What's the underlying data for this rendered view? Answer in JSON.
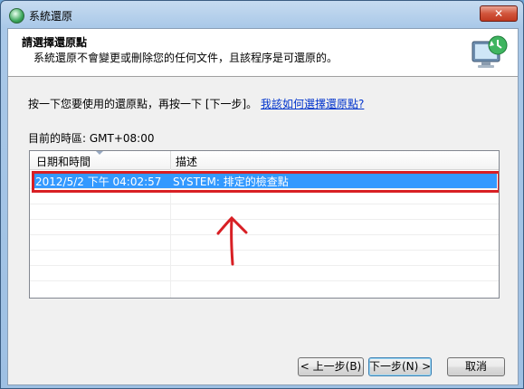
{
  "window": {
    "title": "系統還原",
    "close_label": "✕"
  },
  "header": {
    "title": "請選擇還原點",
    "subtitle": "系統還原不會變更或刪除您的任何文件，且該程序是可還原的。"
  },
  "instruction": {
    "text": "按一下您要使用的還原點，再按一下 [下一步]。",
    "link": "我該如何選擇還原點?"
  },
  "timezone": {
    "text": "目前的時區: GMT+08:00"
  },
  "list": {
    "columns": [
      "日期和時間",
      "描述"
    ],
    "rows": [
      {
        "datetime": "2012/5/2 下午 04:02:57",
        "description": "SYSTEM: 排定的檢查點",
        "selected": true
      }
    ]
  },
  "buttons": {
    "back": "< 上一步(B)",
    "next": "下一步(N) >",
    "cancel": "取消"
  },
  "colors": {
    "selection": "#3399ff",
    "annotation": "#d81f24",
    "link": "#0033cc"
  },
  "icons": {
    "title": "system-restore-icon",
    "header": "system-restore-monitor-icon",
    "annotation": "up-arrow-annotation"
  }
}
